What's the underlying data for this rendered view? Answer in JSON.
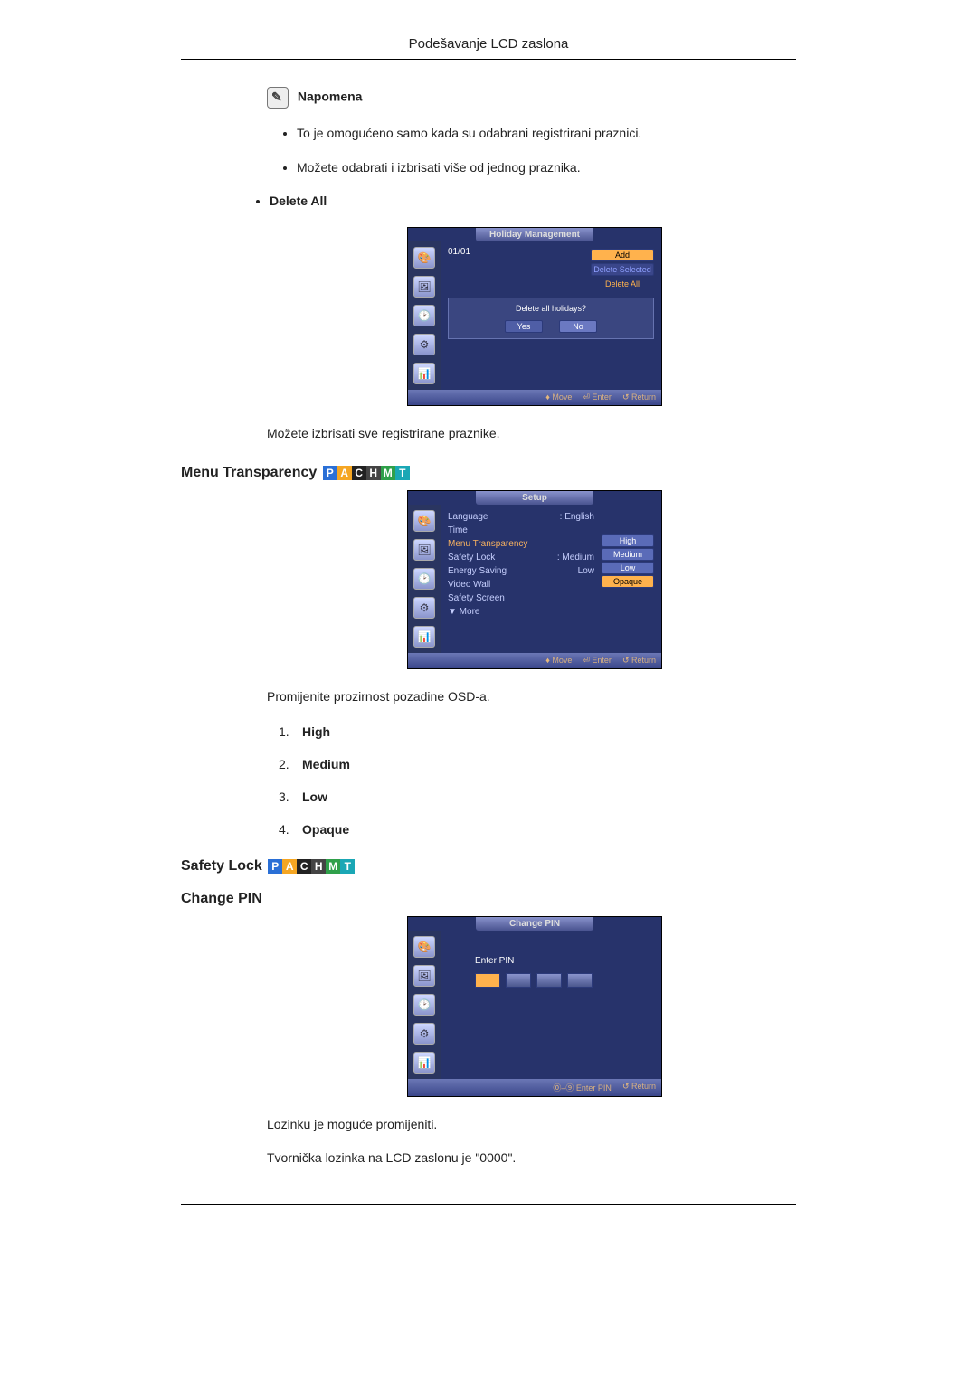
{
  "page_title": "Podešavanje LCD zaslona",
  "note_heading": "Napomena",
  "note_bullets": [
    "To je omogućeno samo kada su odabrani registrirani praznici.",
    "Možete odabrati i izbrisati više od jednog praznika."
  ],
  "delete_all_label": "Delete All",
  "delete_all_desc": "Možete izbrisati sve registrirane praznike.",
  "menu_transparency_heading": "Menu Transparency",
  "transparency_desc": "Promijenite prozirnost pozadine OSD-a.",
  "transparency_options": [
    "High",
    "Medium",
    "Low",
    "Opaque"
  ],
  "safety_lock_heading": "Safety Lock",
  "change_pin_heading": "Change PIN",
  "change_pin_desc1": "Lozinku je moguće promijeniti.",
  "change_pin_desc2": "Tvornička lozinka na LCD zaslonu je \"0000\".",
  "osd_footer": {
    "move": "Move",
    "enter": "Enter",
    "return": "Return"
  },
  "osd1": {
    "title": "Holiday Management",
    "date": "01/01",
    "actions": {
      "add": "Add",
      "delete_selected": "Delete Selected",
      "delete_all": "Delete All"
    },
    "dialog": {
      "question": "Delete all holidays?",
      "yes": "Yes",
      "no": "No"
    }
  },
  "osd2": {
    "title": "Setup",
    "items": {
      "language": "Language",
      "language_value": ": English",
      "time": "Time",
      "menu_transparency": "Menu Transparency",
      "safety_lock": "Safety Lock",
      "energy_saving": "Energy Saving",
      "video_wall": "Video Wall",
      "safety_screen": "Safety Screen",
      "more": "▼ More"
    },
    "options": {
      "high": "High",
      "medium": "Medium",
      "low": "Low",
      "opaque": "Opaque"
    },
    "colon_medium": ": Medium",
    "colon_low": ": Low"
  },
  "osd3": {
    "title": "Change PIN",
    "enter_pin": "Enter PIN",
    "footer_text": "Enter PIN"
  },
  "pachmt": {
    "p": "P",
    "a": "A",
    "c": "C",
    "h": "H",
    "m": "M",
    "t": "T"
  }
}
